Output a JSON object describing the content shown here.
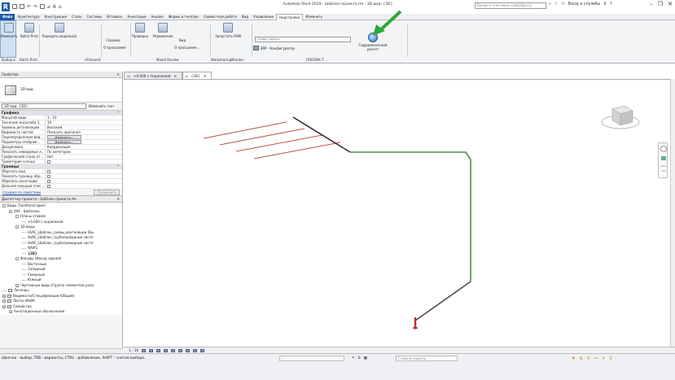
{
  "window": {
    "title": "Autodesk Revit 2019 - Шаблон проекта.rte - 3D вид: {3D}",
    "search_placeholder": "Введите ключевое слово/фразу",
    "signin": "Вход в службы",
    "help": "?"
  },
  "ribbon_tabs": [
    "Файл",
    "Архитектура",
    "Конструкция",
    "Сталь",
    "Системы",
    "Вставить",
    "Аннотации",
    "Анализ",
    "Формы и генплан",
    "Совместная работа",
    "Вид",
    "Управление",
    "Надстройки",
    "Изменить"
  ],
  "ribbon": {
    "modify": "Изменить",
    "batch_print": "Batch Print",
    "transfer": "Передать модель(и)",
    "help": "Справка",
    "about": "О программе",
    "check": "Проверка",
    "manage": "Управление",
    "view": "Вид",
    "about2": "О программе...",
    "run_rsm": "Запустить RSM",
    "bim_config": "BIM - Конфигуратор",
    "input_placeholder": "Сервис вопрос",
    "hydro": "Гидравлический расчет",
    "panels": {
      "select": "Выбор",
      "batch": "Batch Print",
      "etransmit": "eTransmit",
      "model_review": "Model Review",
      "worksharing": "WorksharingMonitor",
      "plazma": "ПЛАЗМА-Т"
    }
  },
  "properties": {
    "header": "Свойства",
    "type_name": "3D вид",
    "view_selector": "3D вид: {3D}",
    "edit_type": "Изменить тип",
    "group_graphics": "Графика",
    "rows": [
      {
        "k": "Масштаб вида",
        "v": "1 : 10"
      },
      {
        "k": "Значение масштаба  1:",
        "v": "10"
      },
      {
        "k": "Уровень детализации",
        "v": "Высокий"
      },
      {
        "k": "Видимость частей",
        "v": "Показать оригинал"
      },
      {
        "k": "Переопределения вид...",
        "btn": "Изменить..."
      },
      {
        "k": "Параметры отображ...",
        "btn": "Изменить..."
      },
      {
        "k": "Дисциплина",
        "v": "Координация"
      },
      {
        "k": "Показать невидимые л...",
        "v": "По категории"
      },
      {
        "k": "Графический стиль от...",
        "v": "Нет"
      },
      {
        "k": "Траектория солнца",
        "chk": true
      }
    ],
    "group_extents": "Границы",
    "rows2": [
      {
        "k": "Обрезать вид",
        "chk": true
      },
      {
        "k": "Показать границу обр...",
        "chk": true
      },
      {
        "k": "Обрезать аннотации",
        "chk": true
      },
      {
        "k": "Дальняя секущая плос...",
        "chk": true
      }
    ],
    "help_link": "Справка по свойствам",
    "apply": "Применить"
  },
  "browser": {
    "header": "Диспетчер проекта - Шаблон проекта.rte",
    "nodes": [
      {
        "d": 0,
        "t": "Виды (Тип/Категория)",
        "tg": "-"
      },
      {
        "d": 1,
        "t": "000 - Шаблоны",
        "tg": "-"
      },
      {
        "d": 2,
        "t": "Планы этажей",
        "tg": "-"
      },
      {
        "d": 3,
        "t": "+0.000 с подложкой"
      },
      {
        "d": 2,
        "t": "3D виды",
        "tg": "-"
      },
      {
        "d": 3,
        "t": "HVAC_Шаблон_схемы_вентиляции (Вы"
      },
      {
        "d": 3,
        "t": "HVAC_Шаблон_трубопроводные систе"
      },
      {
        "d": 3,
        "t": "HVAC_Шаблон_трубопроводные систе"
      },
      {
        "d": 3,
        "t": "NAVIS"
      },
      {
        "d": 3,
        "t": "{3D}",
        "b": true
      },
      {
        "d": 2,
        "t": "Фасады (Фасад здания)",
        "tg": "-"
      },
      {
        "d": 3,
        "t": "Восточный"
      },
      {
        "d": 3,
        "t": "Западный"
      },
      {
        "d": 3,
        "t": "Северный"
      },
      {
        "d": 3,
        "t": "Южный"
      },
      {
        "d": 2,
        "t": "Чертежные виды (Группа элементов узла)",
        "tg": "+"
      },
      {
        "d": 0,
        "t": "Легенды",
        "fi": true
      },
      {
        "d": 0,
        "t": "Ведомости/Спецификации (Общий)",
        "fi": true,
        "tg": "+"
      },
      {
        "d": 0,
        "t": "Листы (МоМ)",
        "fi": true,
        "tg": "+"
      },
      {
        "d": 0,
        "t": "Семейства",
        "fi": true,
        "tg": "+"
      },
      {
        "d": 1,
        "t": "Аннотационные обозначения",
        "tg": "+"
      }
    ]
  },
  "doc_tabs": [
    {
      "label": "+0.000 с подложкой"
    },
    {
      "label": "{3D}",
      "active": true
    }
  ],
  "view_control": {
    "scale": "1 : 10"
  },
  "status": {
    "message": "Щелчок - выбор, TAB - варианты, CTRL - добавление, SHIFT - снятие выбора.",
    "zero": "0",
    "model_placeholder": "Главная модель"
  },
  "colors": {
    "pipe_dark": "#3a2a26",
    "pipe_red": "#b8533e",
    "pipe_green": "#4e8c4e",
    "arrow": "#2eaa3a",
    "file_tab": "#1f5aa8"
  }
}
